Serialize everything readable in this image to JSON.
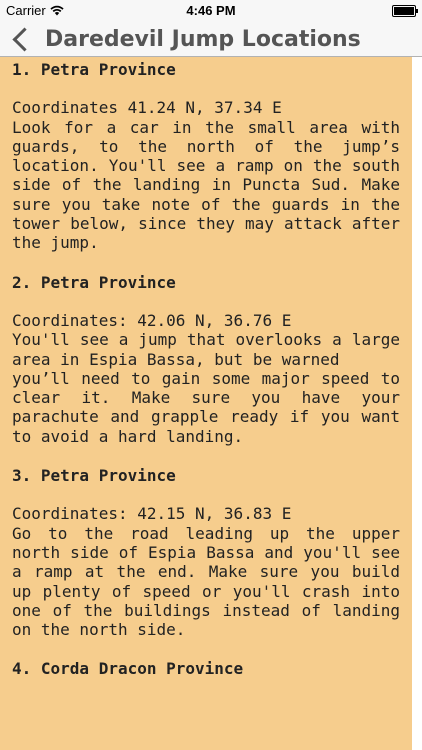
{
  "status_bar": {
    "carrier": "Carrier",
    "time": "4:46 PM"
  },
  "nav": {
    "title": "Daredevil Jump Locations"
  },
  "locations": [
    {
      "title": "1. Petra Province",
      "coordinates": "Coordinates 41.24 N, 37.34 E",
      "description": "Look for a car in the small area with guards, to the north of the jump’s location. You'll see a ramp on the south side of the landing in Puncta Sud. Make sure you take note of the guards in the tower below, since they may attack after the jump."
    },
    {
      "title": "2. Petra Province",
      "coordinates": "Coordinates: 42.06 N, 36.76 E",
      "description_line1": "You'll see a jump that overlooks a large area in Espia Bassa, but be warned",
      "description_line2": "you’ll need to gain some major speed to clear it. Make sure you have your parachute and grapple ready if you want to avoid a hard landing."
    },
    {
      "title": "3. Petra Province",
      "coordinates": "Coordinates: 42.15 N, 36.83 E",
      "description": "Go to the road leading up the upper north side of Espia Bassa and you'll see a ramp at the end. Make sure you build up plenty of speed or you'll crash into one of the buildings instead of landing on the north side."
    },
    {
      "title": "4. Corda Dracon Province"
    }
  ]
}
